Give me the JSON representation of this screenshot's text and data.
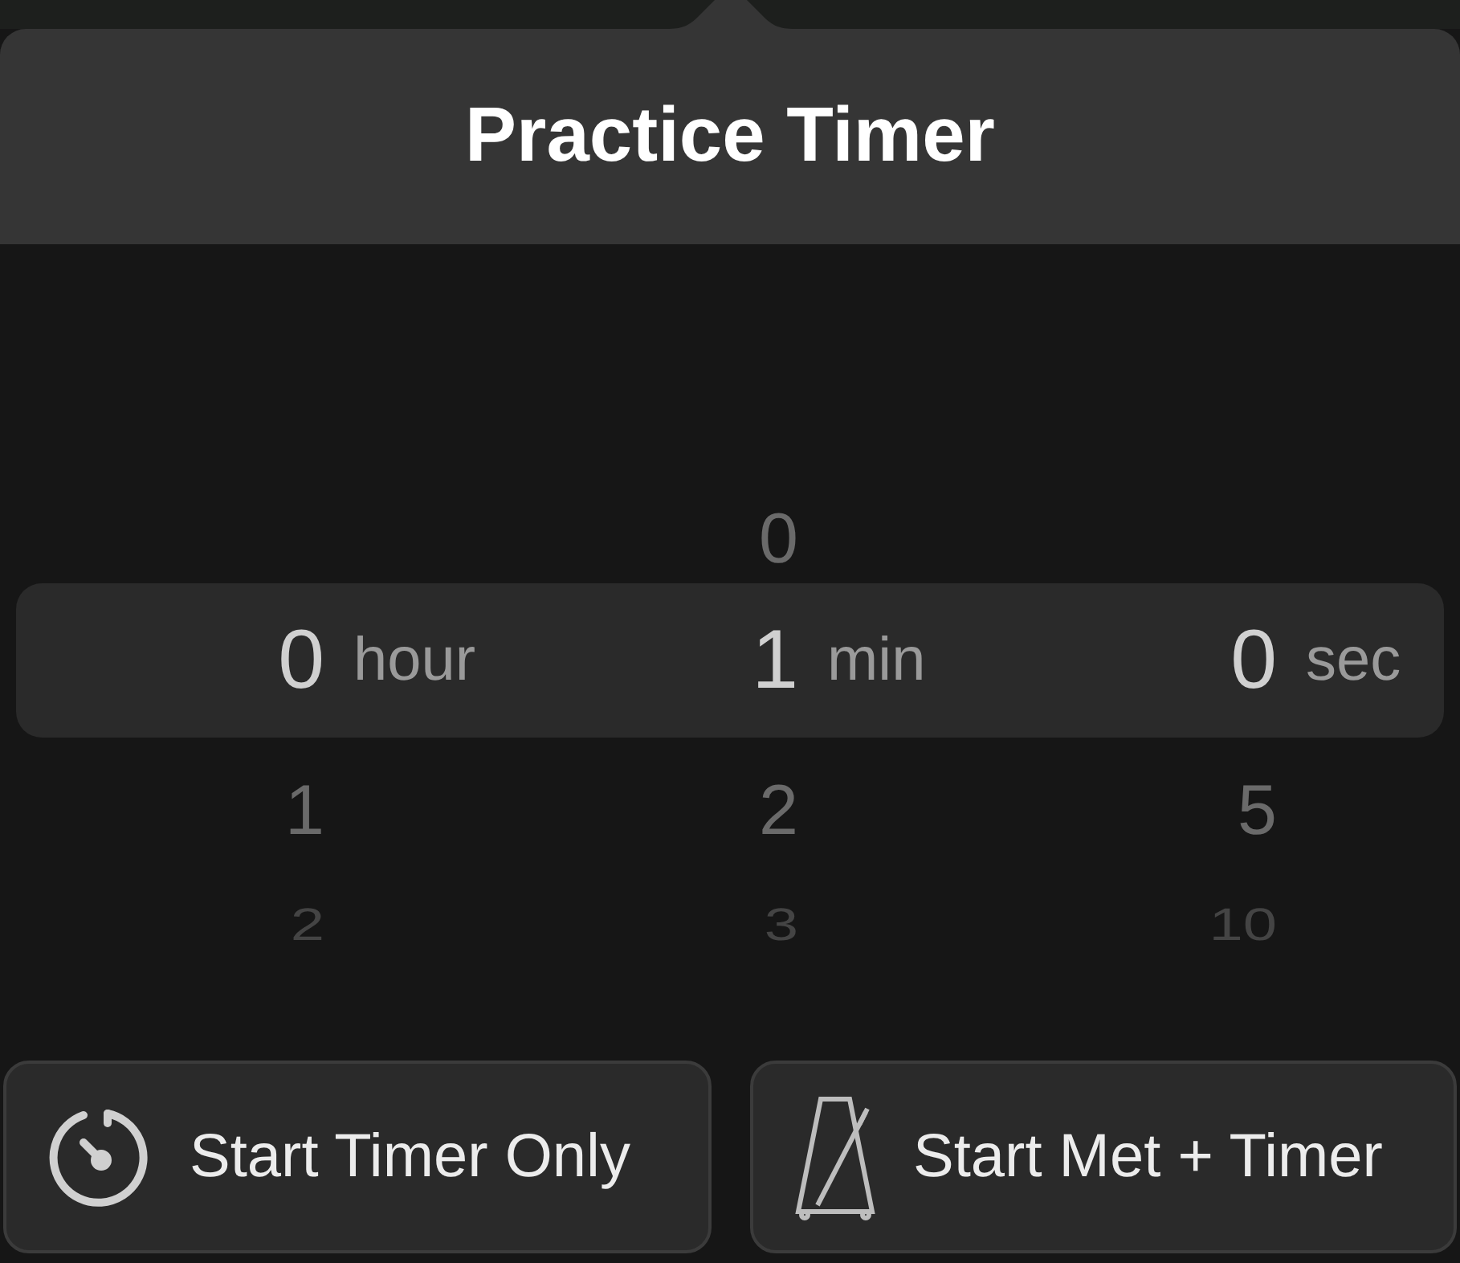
{
  "title": "Practice Timer",
  "picker": [
    {
      "unit": "hour",
      "items": [
        {
          "value": "0",
          "selected": true
        },
        {
          "value": "1",
          "selected": false
        },
        {
          "value": "2",
          "selected": false
        }
      ]
    },
    {
      "unit": "min",
      "items": [
        {
          "value": "0",
          "selected": false
        },
        {
          "value": "1",
          "selected": true
        },
        {
          "value": "2",
          "selected": false
        },
        {
          "value": "3",
          "selected": false
        }
      ]
    },
    {
      "unit": "sec",
      "items": [
        {
          "value": "0",
          "selected": true
        },
        {
          "value": "5",
          "selected": false
        },
        {
          "value": "10",
          "selected": false
        }
      ]
    }
  ],
  "buttons": [
    {
      "kind": "timer",
      "label": "Start Timer Only"
    },
    {
      "kind": "metronome",
      "label": "Start Met + Timer"
    }
  ]
}
